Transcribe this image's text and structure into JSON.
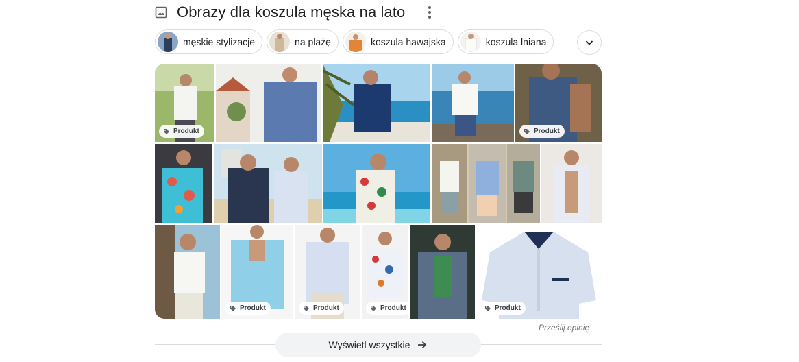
{
  "header": {
    "title": "Obrazy dla koszula męska na lato"
  },
  "chips": [
    {
      "label": "męskie stylizacje"
    },
    {
      "label": "na plażę"
    },
    {
      "label": "koszula hawajska"
    },
    {
      "label": "koszula lniana"
    }
  ],
  "badges": {
    "product_label": "Produkt"
  },
  "footer": {
    "feedback_label": "Prześlij opinię",
    "show_all_label": "Wyświetl wszystkie"
  },
  "colors": {
    "accent_text": "#202124",
    "muted_text": "#70757a",
    "chip_border": "#dadce0",
    "button_bg": "#f1f3f4"
  }
}
